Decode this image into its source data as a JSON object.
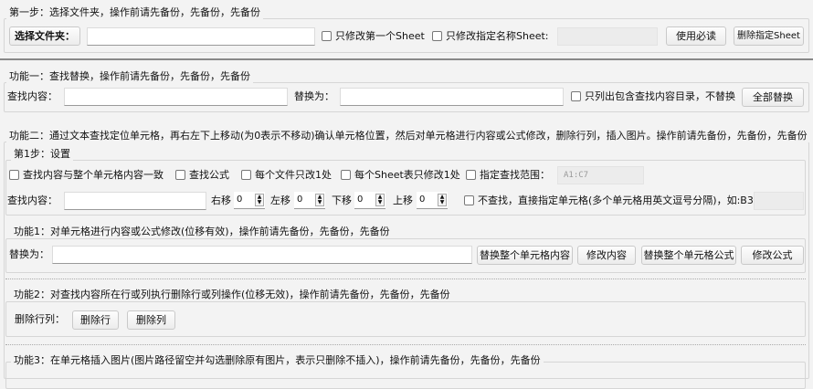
{
  "step1": {
    "legend": "第一步：选择文件夹，操作前请先备份，先备份，先备份",
    "choose_folder": "选择文件夹：",
    "folder_value": "",
    "first_sheet_only": "只修改第一个Sheet",
    "named_sheet_only": "只修改指定名称Sheet:",
    "sheet_name_value": "",
    "readme_button": "使用必读",
    "delete_sheet_button": "删除指定Sheet"
  },
  "func1": {
    "legend": "功能一：查找替换，操作前请先备份，先备份，先备份",
    "find_label": "查找内容：",
    "find_value": "",
    "replace_label": "替换为：",
    "replace_value": "",
    "list_only": "只列出包含查找内容目录，不替换",
    "replace_all_button": "全部替换"
  },
  "func2": {
    "legend": "功能二：通过文本查找定位单元格，再右左下上移动(为0表示不移动)确认单元格位置，然后对单元格进行内容或公式修改，删除行列，插入图片。操作前请先备份，先备份，先备份",
    "settings": {
      "legend": "第1步：设置",
      "match_whole": "查找内容与整个单元格内容一致",
      "find_formula": "查找公式",
      "once_per_file": "每个文件只改1处",
      "once_per_sheet": "每个Sheet表只修改1处",
      "range": "指定查找范围：",
      "range_placeholder": "A1:C7",
      "find_label": "查找内容：",
      "find_value": "",
      "right": "右移",
      "right_val": "0",
      "left": "左移",
      "left_val": "0",
      "down": "下移",
      "down_val": "0",
      "up": "上移",
      "up_val": "0",
      "direct_cell": "不查找，直接指定单元格(多个单元格用英文逗号分隔)，如:B3",
      "direct_cell_value": ""
    },
    "f1": {
      "legend": "功能1：对单元格进行内容或公式修改(位移有效)，操作前请先备份，先备份，先备份",
      "replace_label": "替换为：",
      "replace_value": "",
      "btn_replace_content": "替换整个单元格内容",
      "btn_modify_content": "修改内容",
      "btn_replace_formula": "替换整个单元格公式",
      "btn_modify_formula": "修改公式"
    },
    "f2": {
      "legend": "功能2：对查找内容所在行或列执行删除行或列操作(位移无效)，操作前请先备份，先备份，先备份",
      "label": "删除行列：",
      "btn_row": "删除行",
      "btn_col": "删除列"
    },
    "f3": {
      "legend": "功能3：在单元格插入图片(图片路径留空并勾选删除原有图片，表示只删除不插入)，操作前请先备份，先备份，先备份"
    }
  }
}
